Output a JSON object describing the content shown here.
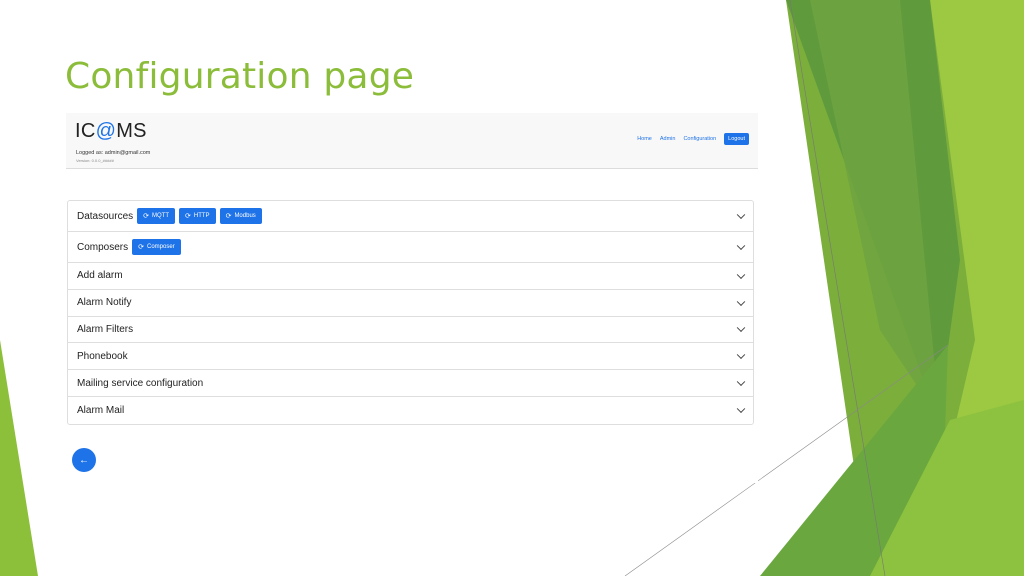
{
  "slide": {
    "title": "Configuration page"
  },
  "colors": {
    "title": "#8bbd3a",
    "primary": "#1e73e8",
    "green_dark": "#5f9a3c",
    "green_light": "#a5cd4a"
  },
  "app": {
    "logo_prefix": "IC",
    "logo_at": "@",
    "logo_suffix": "MS",
    "logged_as": "Logged as: admin@gmail.com",
    "version": "Version: 0.0.0_#####",
    "nav": [
      "Home",
      "Admin",
      "Configuration"
    ],
    "logout": "Logout"
  },
  "accordion": [
    {
      "label": "Datasources",
      "chips": [
        "MQTT",
        "HTTP",
        "Modbus"
      ]
    },
    {
      "label": "Composers",
      "chips": [
        "Composer"
      ]
    },
    {
      "label": "Add alarm"
    },
    {
      "label": "Alarm Notify"
    },
    {
      "label": "Alarm Filters"
    },
    {
      "label": "Phonebook"
    },
    {
      "label": "Mailing service configuration"
    },
    {
      "label": "Alarm Mail"
    }
  ],
  "icons": {
    "chip": "refresh-icon",
    "chevron": "chevron-down-icon",
    "back": "arrow-left-icon"
  }
}
